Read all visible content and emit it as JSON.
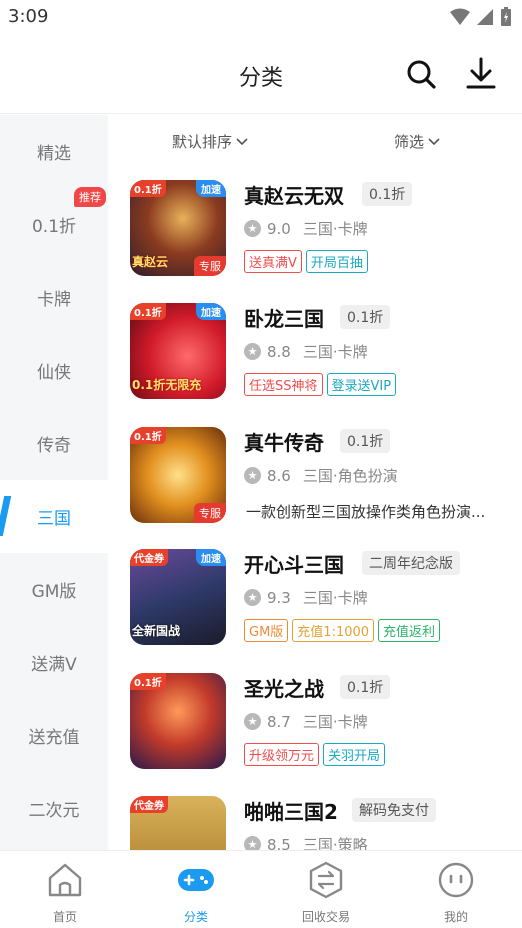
{
  "status_bar": {
    "time": "3:09"
  },
  "header": {
    "title": "分类"
  },
  "sidebar": {
    "items": [
      {
        "label": "精选"
      },
      {
        "label": "0.1折",
        "badge": "推荐"
      },
      {
        "label": "卡牌"
      },
      {
        "label": "仙侠"
      },
      {
        "label": "传奇"
      },
      {
        "label": "三国",
        "active": true
      },
      {
        "label": "GM版"
      },
      {
        "label": "送满V"
      },
      {
        "label": "送充值"
      },
      {
        "label": "二次元"
      }
    ]
  },
  "filters": {
    "sort_label": "默认排序",
    "filter_label": "筛选"
  },
  "games": [
    {
      "name": "真赵云无双",
      "pill": "0.1折",
      "rating": "9.0",
      "category": "三国·卡牌",
      "tags": [
        "送真满V",
        "开局百抽"
      ],
      "icon_badges": {
        "top_left": "0.1折",
        "top_right": "加速",
        "bottom_right": "专服",
        "overlay": "真赵云"
      }
    },
    {
      "name": "卧龙三国",
      "pill": "0.1折",
      "rating": "8.8",
      "category": "三国·卡牌",
      "tags": [
        "任选SS神将",
        "登录送VIP"
      ],
      "icon_badges": {
        "top_left": "0.1折",
        "top_right": "加速",
        "overlay": "0.1折无限充"
      }
    },
    {
      "name": "真牛传奇",
      "pill": "0.1折",
      "rating": "8.6",
      "category": "三国·角色扮演",
      "description": "一款创新型三国放操作类角色扮演...",
      "icon_badges": {
        "top_left": "0.1折",
        "bottom_right": "专服"
      }
    },
    {
      "name": "开心斗三国",
      "pill": "二周年纪念版",
      "rating": "9.3",
      "category": "三国·卡牌",
      "tags": [
        "GM版",
        "充值1:1000",
        "充值返利"
      ],
      "icon_badges": {
        "top_left": "代金券",
        "top_right": "加速",
        "overlay": "全新国战"
      }
    },
    {
      "name": "圣光之战",
      "pill": "0.1折",
      "rating": "8.7",
      "category": "三国·卡牌",
      "tags": [
        "升级领万元",
        "关羽开局"
      ],
      "icon_badges": {
        "top_left": "0.1折"
      }
    },
    {
      "name": "啪啪三国2",
      "pill": "解码免支付",
      "rating": "8.5",
      "category": "三国·策略",
      "icon_badges": {
        "top_left": "代金券"
      }
    }
  ],
  "bottom_nav": [
    {
      "label": "首页"
    },
    {
      "label": "分类",
      "active": true
    },
    {
      "label": "回收交易"
    },
    {
      "label": "我的"
    }
  ],
  "colors": {
    "accent": "#1a9bf0",
    "badge_red": "#f04848"
  }
}
